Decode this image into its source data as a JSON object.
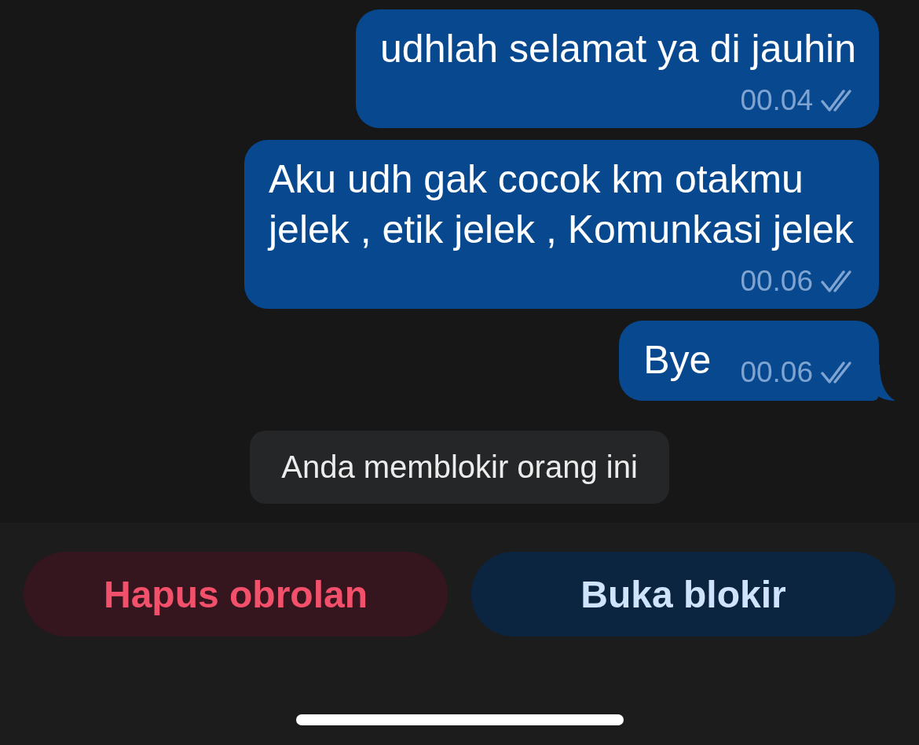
{
  "messages": [
    {
      "text": "udhlah selamat ya di jauhin",
      "time": "00.04",
      "read": true,
      "tail": false
    },
    {
      "text": "Aku udh gak cocok km otakmu jelek , etik jelek , Komunkasi jelek",
      "time": "00.06",
      "read": true,
      "tail": false
    },
    {
      "text": "Bye",
      "time": "00.06",
      "read": true,
      "tail": true
    }
  ],
  "notice": "Anda memblokir orang ini",
  "actions": [
    {
      "label": "Hapus obrolan",
      "kind": "destructive"
    },
    {
      "label": "Buka blokir",
      "kind": "primary"
    }
  ]
}
